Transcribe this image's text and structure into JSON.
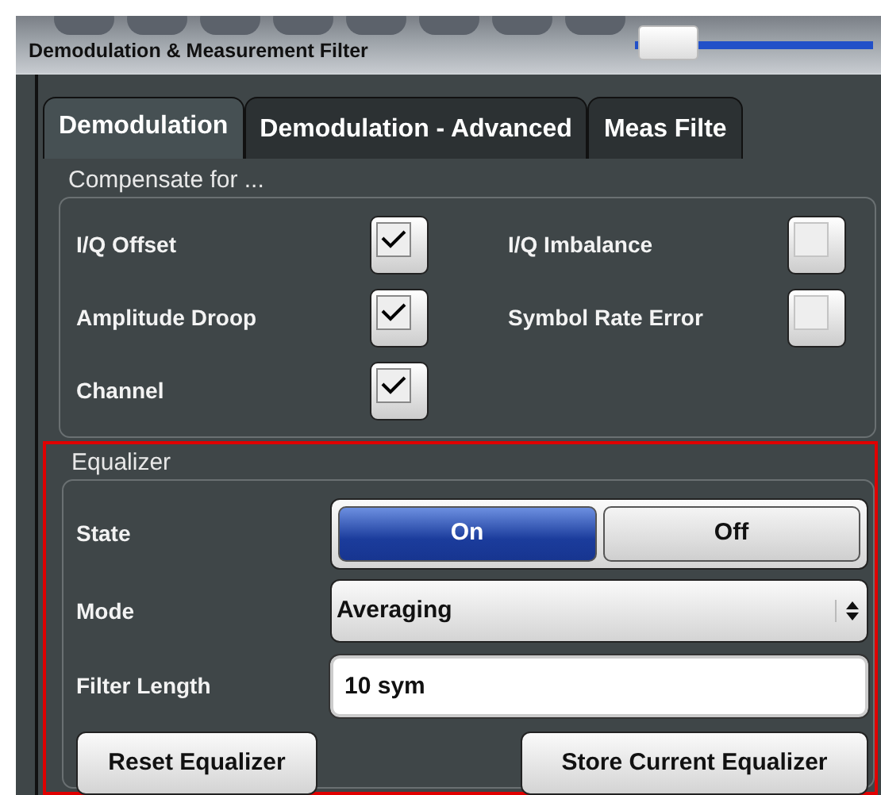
{
  "window": {
    "title": "Demodulation & Measurement Filter"
  },
  "zoom_slider": {
    "level": 0.02
  },
  "tabs": [
    {
      "label": "Demodulation",
      "selected": true
    },
    {
      "label": "Demodulation - Advanced",
      "selected": false
    },
    {
      "label": "Meas Filte",
      "selected": false
    }
  ],
  "compensate": {
    "title": "Compensate for ...",
    "items": [
      {
        "label": "I/Q Offset",
        "checked": true
      },
      {
        "label": "I/Q Imbalance",
        "checked": false
      },
      {
        "label": "Amplitude Droop",
        "checked": true
      },
      {
        "label": "Symbol Rate Error",
        "checked": false
      },
      {
        "label": "Channel",
        "checked": true
      }
    ]
  },
  "equalizer": {
    "title": "Equalizer",
    "highlighted": true,
    "state": {
      "label": "State",
      "options": [
        {
          "label": "On",
          "selected": true
        },
        {
          "label": "Off",
          "selected": false
        }
      ]
    },
    "mode": {
      "label": "Mode",
      "value": "Averaging"
    },
    "filter_length": {
      "label": "Filter Length",
      "value": "10 sym"
    },
    "buttons": [
      "Reset Equalizer",
      "Store Current Equalizer"
    ]
  }
}
